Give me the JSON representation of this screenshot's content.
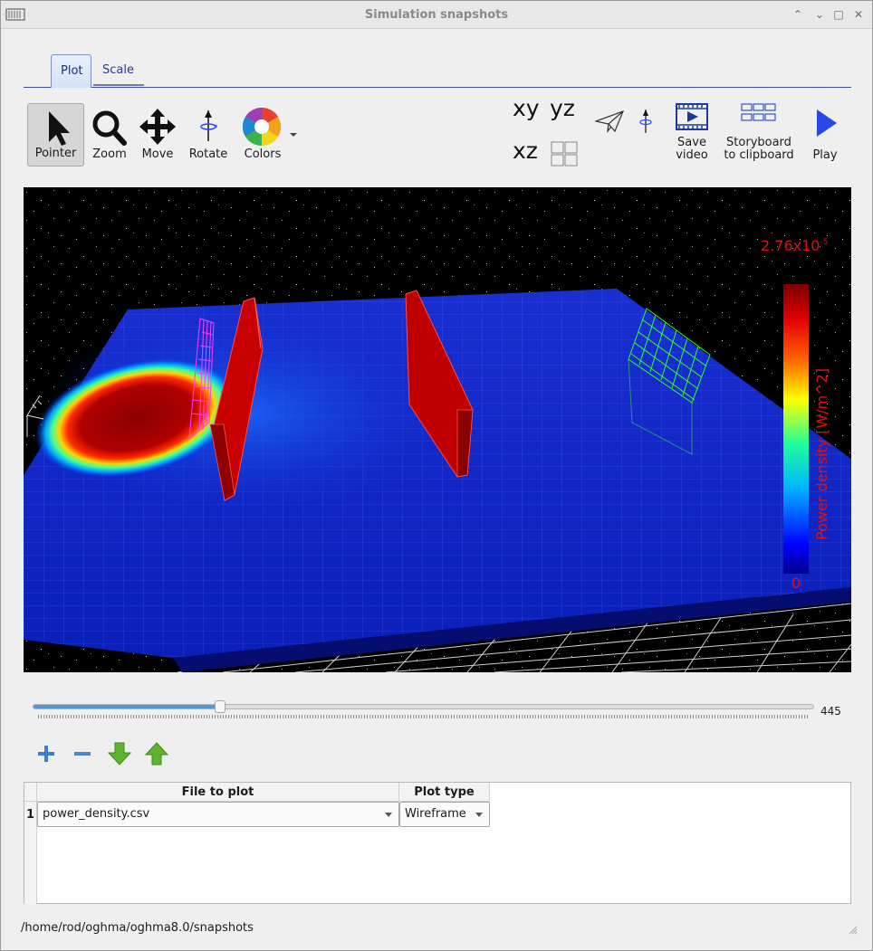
{
  "window": {
    "title": "Simulation snapshots"
  },
  "tabs": [
    {
      "label": "Plot"
    },
    {
      "label": "Scale"
    }
  ],
  "toolbar": {
    "pointer": "Pointer",
    "zoom": "Zoom",
    "move": "Move",
    "rotate": "Rotate",
    "colors": "Colors",
    "view_xy": "xy",
    "view_yz": "yz",
    "view_xz": "xz",
    "save_video_1": "Save",
    "save_video_2": "video",
    "storyboard_1": "Storyboard",
    "storyboard_2": "to clipboard",
    "play": "Play"
  },
  "colorbar": {
    "max_base": "2.76x10",
    "max_exp": "-5",
    "min": "0",
    "label": "Power density [W/m^2]"
  },
  "slider": {
    "value": "445",
    "position_fraction": 0.24
  },
  "table": {
    "headers": [
      "File to plot",
      "Plot type"
    ],
    "rows": [
      {
        "index": "1",
        "file": "power_density.csv",
        "type": "Wireframe"
      }
    ]
  },
  "status": {
    "path": "/home/rod/oghma/oghma8.0/snapshots"
  }
}
